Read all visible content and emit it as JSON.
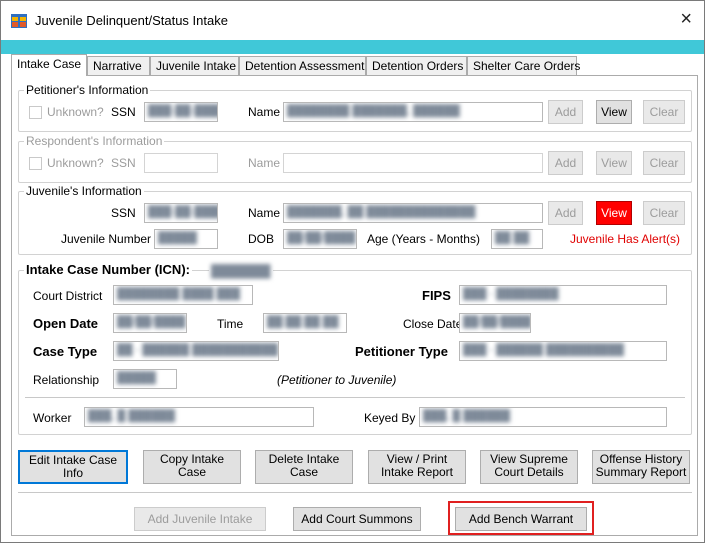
{
  "window": {
    "title": "Juvenile Delinquent/Status Intake",
    "close": "×"
  },
  "tabs": [
    {
      "label": "Intake Case",
      "active": true
    },
    {
      "label": "Narrative"
    },
    {
      "label": "Juvenile Intake"
    },
    {
      "label": "Detention Assessment"
    },
    {
      "label": "Detention Orders"
    },
    {
      "label": "Shelter Care Orders"
    }
  ],
  "petitioner": {
    "title": "Petitioner's Information",
    "unknown_label": "Unknown?",
    "ssn_label": "SSN",
    "ssn_value": "███-██-████",
    "name_label": "Name",
    "name_value": "████████ ███████, ██████",
    "add": "Add",
    "view": "View",
    "clear": "Clear"
  },
  "respondent": {
    "title": "Respondent's Information",
    "unknown_label": "Unknown?",
    "ssn_label": "SSN",
    "name_label": "Name",
    "add": "Add",
    "view": "View",
    "clear": "Clear"
  },
  "juvenile": {
    "title": "Juvenile's Information",
    "ssn_label": "SSN",
    "ssn_value": "███-██-████",
    "name_label": "Name",
    "name_value": "███████, ██ ██████████████",
    "add": "Add",
    "view": "View",
    "clear": "Clear",
    "number_label": "Juvenile Number",
    "number_value": "█████",
    "dob_label": "DOB",
    "dob_value": "██/██/████",
    "age_label": "Age (Years - Months)",
    "age_value": "██ ██",
    "alert": "Juvenile Has Alert(s)"
  },
  "intake": {
    "icn_label": "Intake Case Number (ICN):",
    "icn_value": "███████",
    "court_district_label": "Court District",
    "court_district_value": "████████ ████ ███",
    "fips_label": "FIPS",
    "fips_value": "███ - ████████",
    "open_date_label": "Open Date",
    "open_date_value": "██/██/████",
    "time_label": "Time",
    "time_value": "██:██:██ ██",
    "close_date_label": "Close Date",
    "close_date_value": "██/██/████",
    "case_type_label": "Case Type",
    "case_type_value": "██ - ██████ ███████████",
    "petitioner_type_label": "Petitioner Type",
    "petitioner_type_value": "███ - ██████ ██████████",
    "relationship_label": "Relationship",
    "relationship_value": "█████",
    "relationship_note": "(Petitioner to Juvenile)",
    "worker_label": "Worker",
    "worker_value": "███, █ ██████",
    "keyed_by_label": "Keyed By",
    "keyed_by_value": "███, █ ██████"
  },
  "actions": {
    "edit": [
      "Edit Intake Case",
      "Info"
    ],
    "copy": [
      "Copy Intake",
      "Case"
    ],
    "delete": [
      "Delete Intake",
      "Case"
    ],
    "print": [
      "View / Print",
      "Intake Report"
    ],
    "supreme": [
      "View Supreme",
      "Court Details"
    ],
    "offense": [
      "Offense History",
      "Summary Report"
    ],
    "add_juvenile_intake": "Add Juvenile Intake",
    "add_court_summons": "Add Court Summons",
    "add_bench_warrant": "Add Bench Warrant"
  },
  "colors": {
    "accent_bar": "#40c8d8",
    "view_alert_button": "#ff0000",
    "alert_text": "#e00000",
    "highlight_box": "#e02020"
  }
}
